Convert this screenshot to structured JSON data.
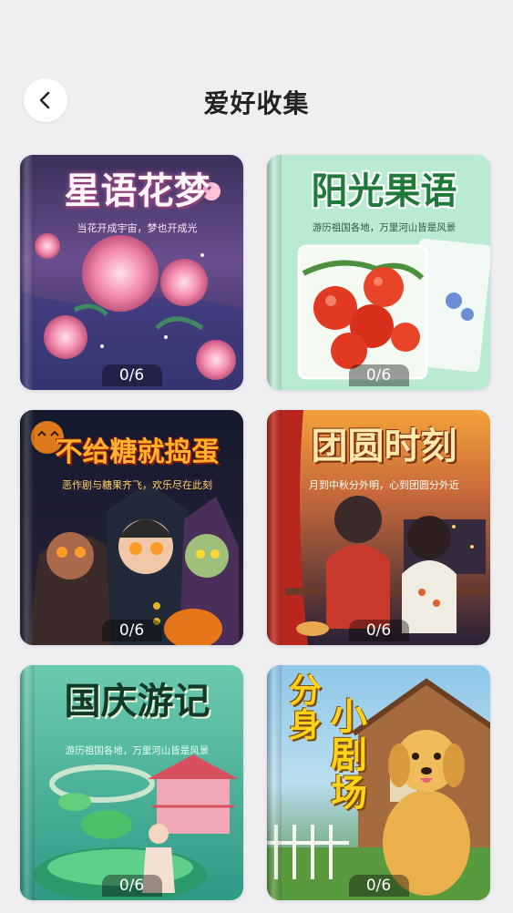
{
  "header": {
    "title": "爱好收集",
    "back_icon": "chevron-left-icon"
  },
  "colors": {
    "background": "#efeff1",
    "title_text": "#222222",
    "badge_background": "rgba(0,0,0,0.38)"
  },
  "cards": [
    {
      "title": "星语花梦",
      "subtitle": "当花开成宇宙，梦也开成光",
      "progress": "0/6"
    },
    {
      "title": "阳光果语",
      "subtitle": "游历祖国各地，万里河山皆是风景",
      "progress": "0/6"
    },
    {
      "title": "不给糖就捣蛋",
      "subtitle": "恶作剧与糖果齐飞，欢乐尽在此刻",
      "progress": "0/6"
    },
    {
      "title": "团圆时刻",
      "subtitle": "月到中秋分外明，心到团圆分外近",
      "progress": "0/6"
    },
    {
      "title": "国庆游记",
      "subtitle": "游历祖国各地，万里河山皆是风景",
      "progress": "0/6"
    },
    {
      "title_line1": "分身",
      "title_line2": "小剧场",
      "progress": "0/6"
    }
  ]
}
